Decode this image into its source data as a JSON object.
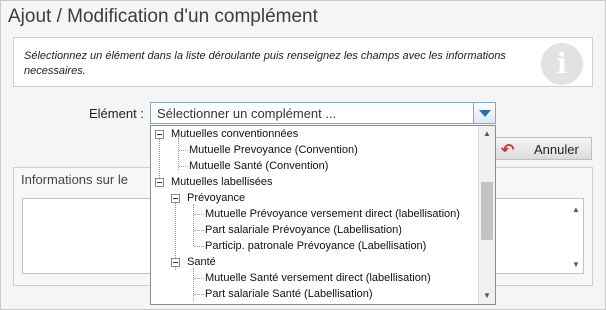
{
  "window": {
    "title": "Ajout / Modification d'un complément"
  },
  "info": {
    "text": "Sélectionnez un élément dans la liste déroulante puis renseignez les champs avec les informations necessaires.",
    "icon": "info-icon",
    "icon_glyph": "i"
  },
  "element_field": {
    "label": "Elément :",
    "selected_value": "Sélectionner un complément ..."
  },
  "buttons": {
    "annuler_label": "Annuler",
    "annuler_icon": "undo-arrow-icon"
  },
  "fieldset": {
    "legend": "Informations sur le"
  },
  "dropdown": {
    "items": [
      "Mutuelles conventionnées",
      "Mutuelle Prevoyance (Convention)",
      "Mutuelle Santé (Convention)",
      "Mutuelles labellisées",
      "Prévoyance",
      "Mutuelle Prévoyance versement direct (labellisation)",
      "Part salariale Prévoyance (Labellisation)",
      "Particip. patronale Prévoyance (Labellisation)",
      "Santé",
      "Mutuelle Santé versement direct (labellisation)",
      "Part salariale Santé (Labellisation)"
    ]
  },
  "colors": {
    "accent": "#2f6ead",
    "border": "#8ca6c3",
    "undo_arrow": "#d23a3a"
  }
}
